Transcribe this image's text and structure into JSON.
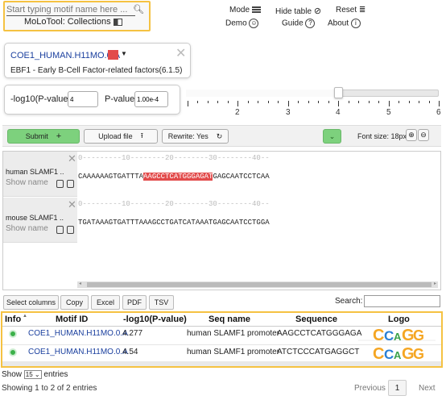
{
  "topbar": {
    "search_placeholder": "Start typing motif name here ...",
    "collections_label": "MoLoTool: Collections",
    "mode_label": "Mode",
    "demo_label": "Demo",
    "hide_table_label": "Hide table",
    "guide_label": "Guide",
    "reset_label": "Reset",
    "about_label": "About"
  },
  "motif_card": {
    "name": "COE1_HUMAN.H11MO.0.A",
    "color": "#e24b4b",
    "description": "EBF1 - Early B-Cell Factor-related factors(6.1.5)"
  },
  "pvalue": {
    "log_label": "-log10(P-value):",
    "log_value": "4",
    "p_label": "P-value:",
    "p_value": "1.00e-4"
  },
  "slider": {
    "value": 4,
    "min": 1,
    "max": 6,
    "ticks": [
      "2",
      "3",
      "4",
      "5",
      "6"
    ]
  },
  "actions": {
    "submit_label": "Submit",
    "submit_icon": "+",
    "upload_label": "Upload file",
    "rewrite_label": "Rewrite: Yes",
    "font_size_label": "Font size: 18px"
  },
  "sequences": [
    {
      "name": "human SLAMF1 ..",
      "show_name": "Show name",
      "ruler": "0---------10--------20--------30--------40--",
      "pre": "CAAAAAAGTGATTTA",
      "hit": "AAGCCTCATGGGAGAT",
      "post": "GAGCAATCCTCAA"
    },
    {
      "name": "mouse SLAMF1 ..",
      "show_name": "Show name",
      "ruler": "0---------10--------20--------30--------40--",
      "pre": "TGATAAAGTGATTTAAAGCCTGATCATAAATGAGCAATCCTGGA",
      "hit": "",
      "post": ""
    }
  ],
  "table_controls": {
    "select_columns": "Select columns",
    "copy": "Copy",
    "excel": "Excel",
    "pdf": "PDF",
    "tsv": "TSV",
    "search_label": "Search:"
  },
  "table": {
    "headers": [
      "Info",
      "Motif ID",
      "-log10(P-value)",
      "Seq name",
      "Sequence",
      "Logo"
    ],
    "rows": [
      {
        "motif": "COE1_HUMAN.H11MO.0.A",
        "log": "4.277",
        "seq_name": "human SLAMF1 promoter",
        "sequence": "AAGCCTCATGGGAGA"
      },
      {
        "motif": "COE1_HUMAN.H11MO.0.A",
        "log": "4.54",
        "seq_name": "human SLAMF1 promoter",
        "sequence": "ATCTCCCATGAGGCT"
      }
    ]
  },
  "footer": {
    "show_label": "Show",
    "show_value": "15",
    "entries_label": "entries",
    "showing": "Showing 1 to 2 of 2 entries",
    "previous": "Previous",
    "page": "1",
    "next": "Next"
  }
}
